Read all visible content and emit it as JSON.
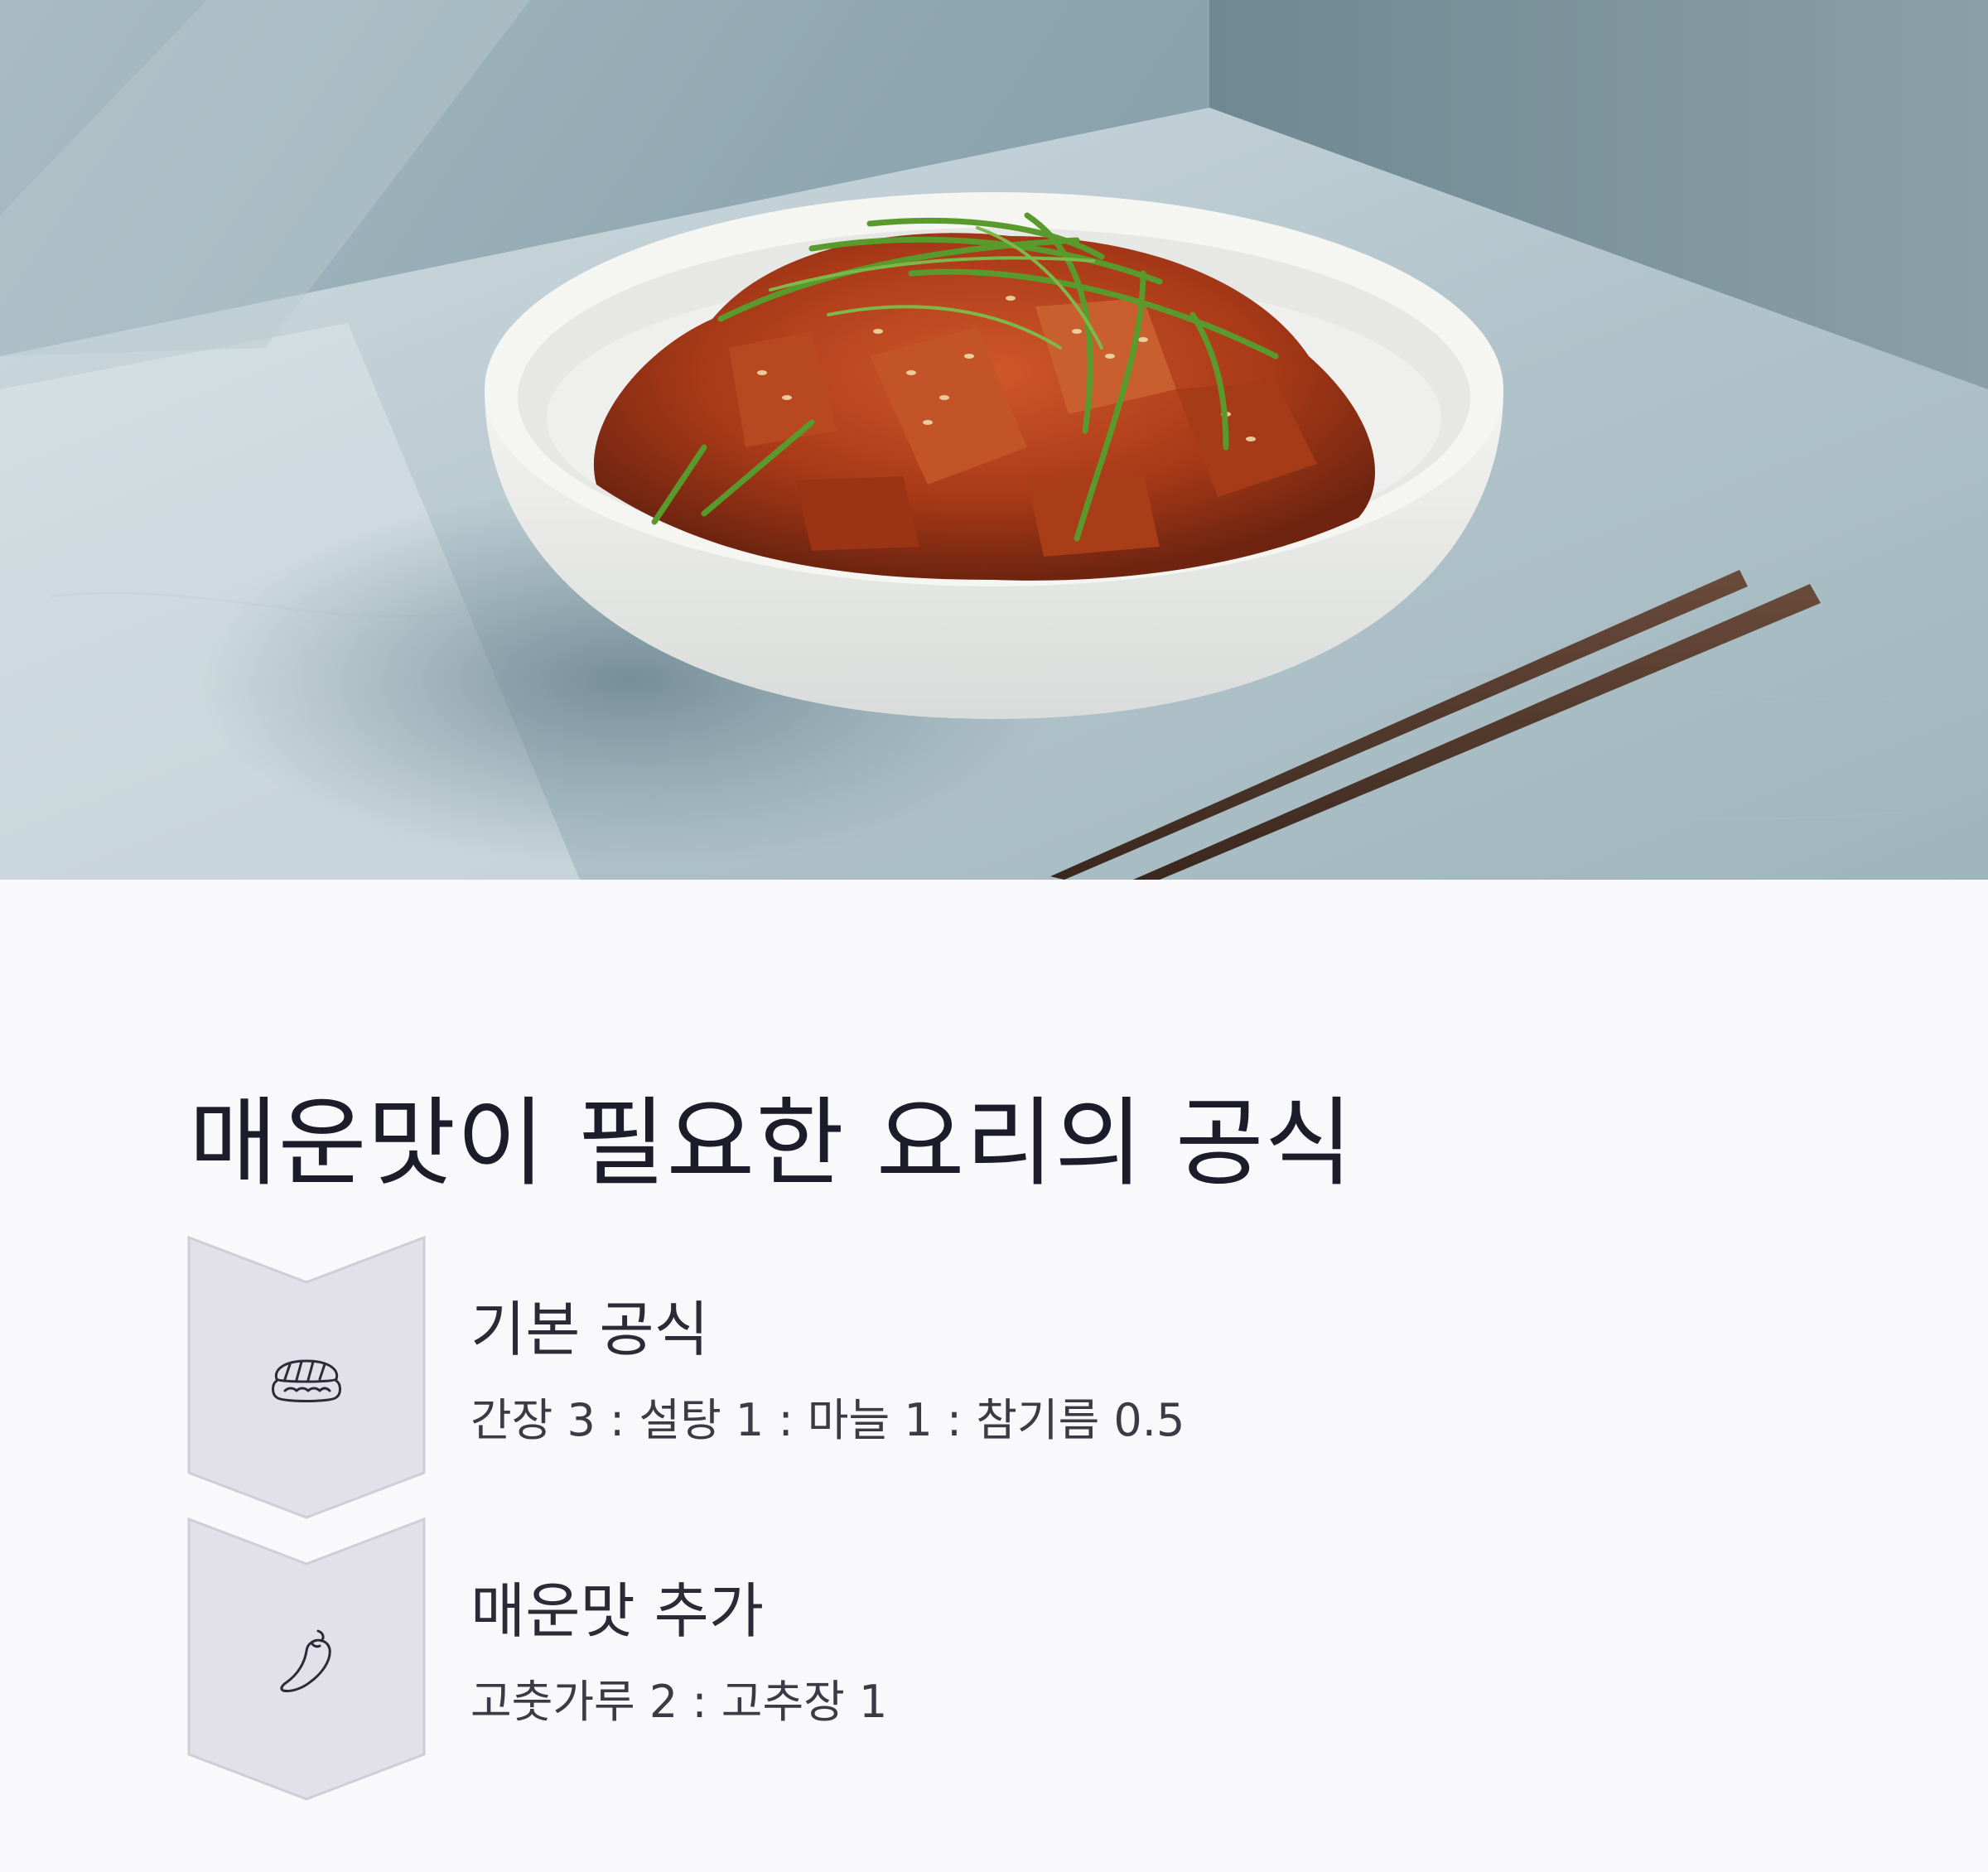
{
  "hero": {
    "image": "spicy-stir-fried-pork-in-white-bowl-with-chopsticks",
    "colors": {
      "wall": "#9fb4bd",
      "counter": "#b9cad1",
      "bowl": "#f1f1ee",
      "sauce": "#b5401d",
      "scallion": "#4f8a2a",
      "chopsticks": "#4a3226"
    }
  },
  "title": "매운맛이 필요한 요리의 공식",
  "steps": [
    {
      "icon": "sushi-icon",
      "title": "기본 공식",
      "desc": "간장 3 : 설탕 1 : 마늘 1 : 참기름 0.5"
    },
    {
      "icon": "chili-pepper-icon",
      "title": "매운맛 추가",
      "desc": "고춧가루 2 : 고추장 1"
    }
  ],
  "colors": {
    "background": "#f9f8fb",
    "badge_fill": "#e2e1ea",
    "badge_stroke": "#cfcdd8",
    "text": "#1d1c2b"
  }
}
